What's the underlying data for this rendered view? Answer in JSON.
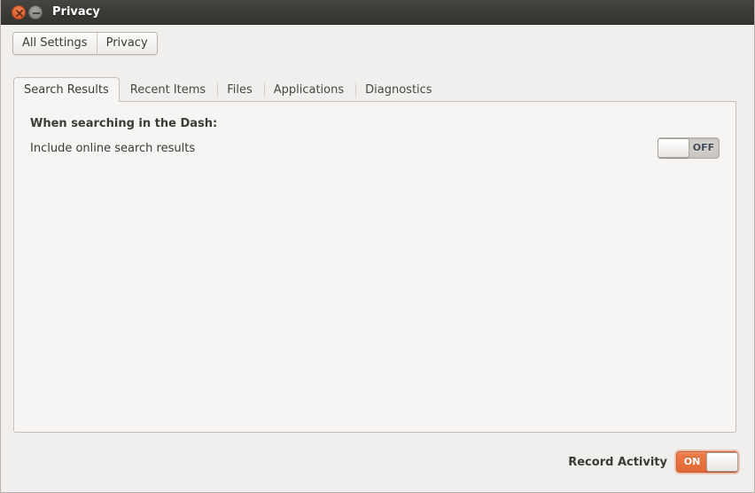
{
  "window": {
    "title": "Privacy",
    "controls": [
      {
        "name": "close",
        "icon": "close-icon",
        "glyph": "×"
      },
      {
        "name": "minimize",
        "icon": "minimize-icon",
        "glyph": "−"
      }
    ]
  },
  "toolbar": {
    "all_settings_label": "All Settings",
    "privacy_label": "Privacy"
  },
  "tabs": [
    {
      "label": "Search Results",
      "active": true
    },
    {
      "label": "Recent Items",
      "active": false
    },
    {
      "label": "Files",
      "active": false
    },
    {
      "label": "Applications",
      "active": false
    },
    {
      "label": "Diagnostics",
      "active": false
    }
  ],
  "panel": {
    "heading": "When searching in the Dash:",
    "online_results": {
      "label": "Include online search results",
      "switch_state": "OFF"
    }
  },
  "footer": {
    "record_activity_label": "Record Activity",
    "record_activity_state": "ON"
  },
  "colors": {
    "titlebar": "#3b3a36",
    "window_background": "#f0efed",
    "panel_background": "#f6f5f4",
    "accent_orange": "#df6a35",
    "close_button": "#e0622f",
    "minimize_button": "#8e8c87",
    "text": "#3c3b37"
  }
}
